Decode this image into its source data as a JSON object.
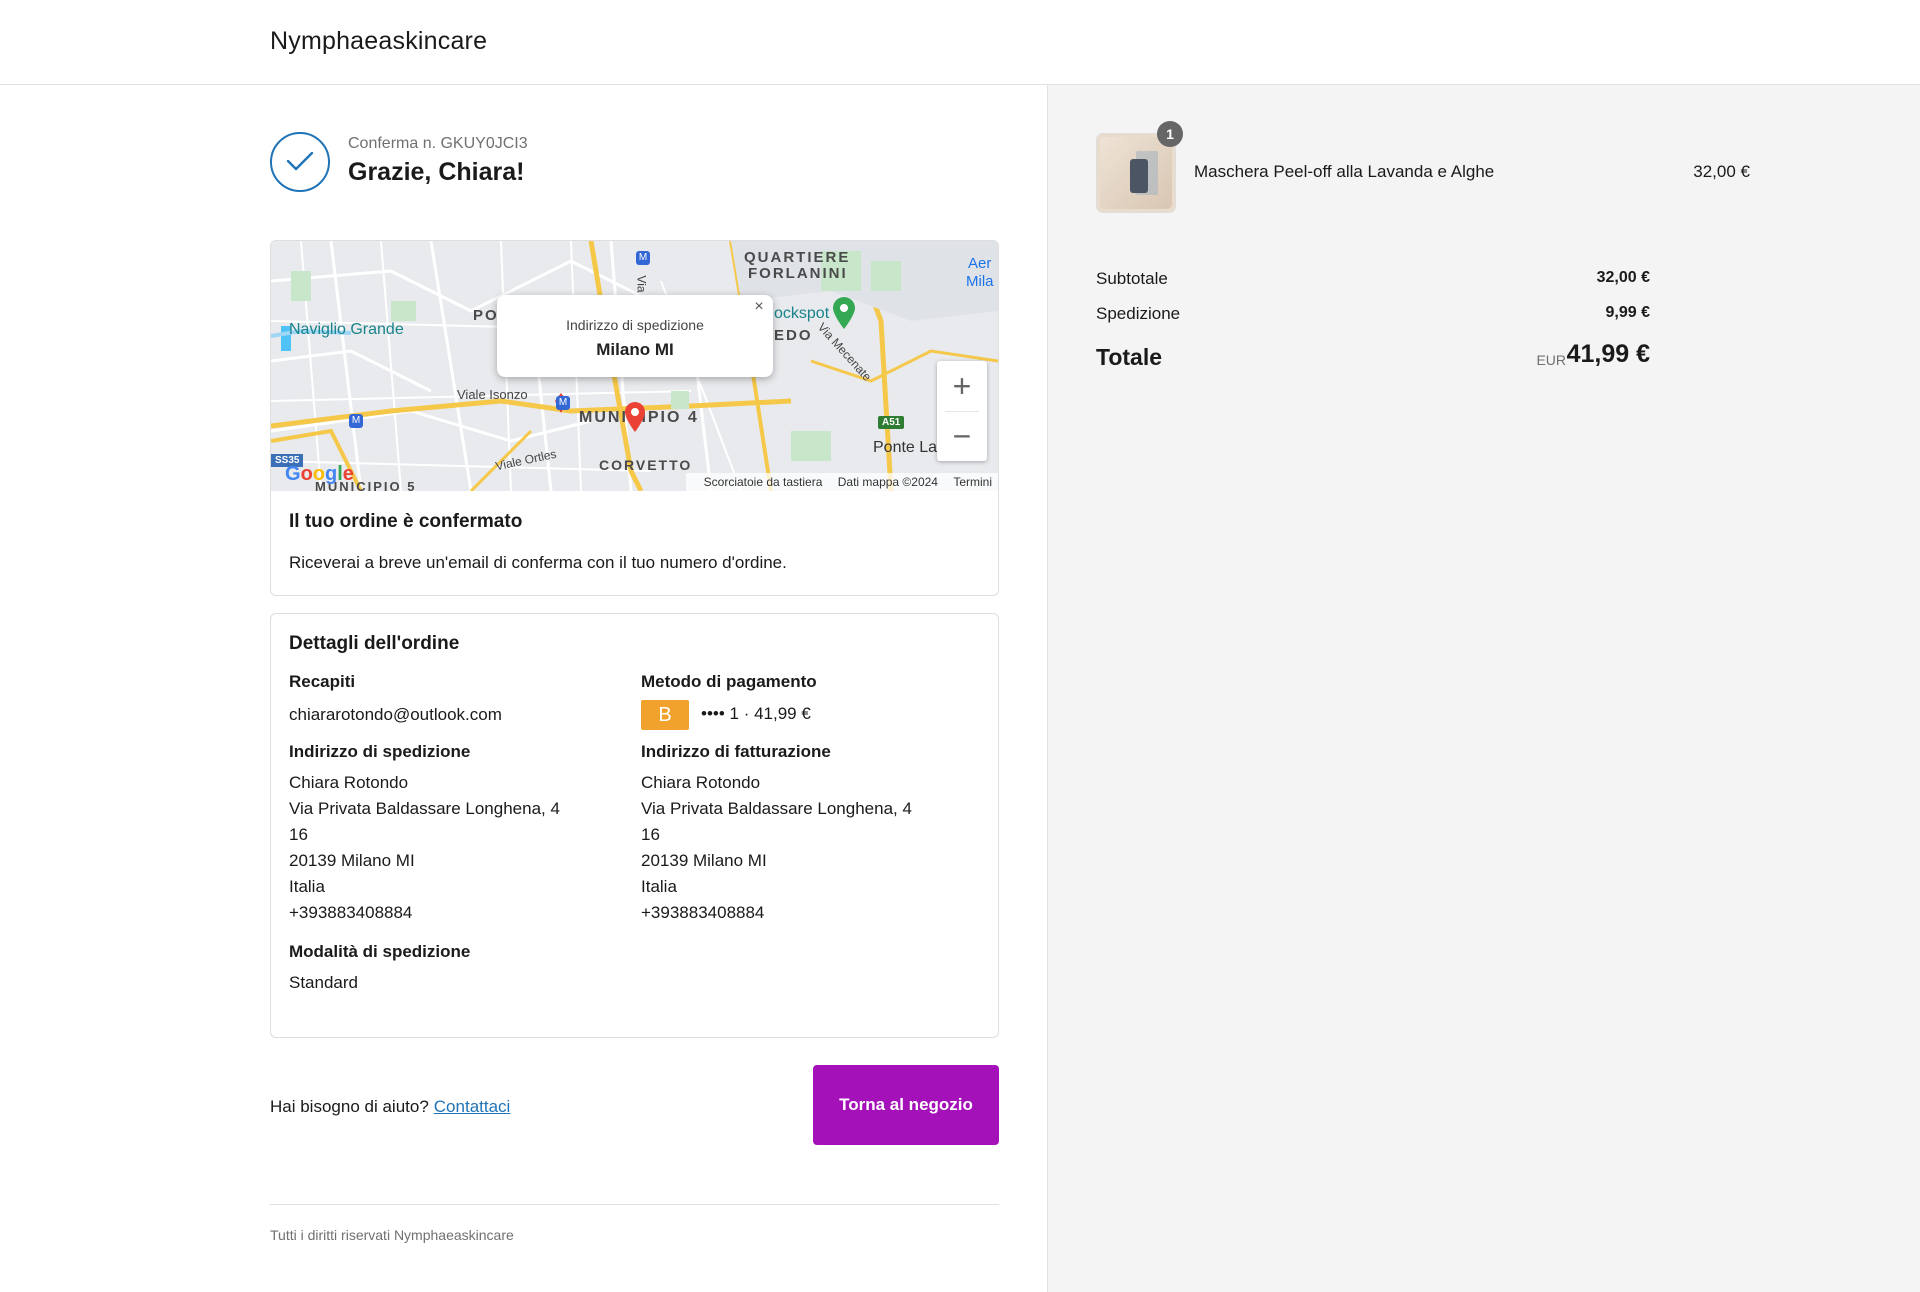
{
  "header": {
    "brand": "Nymphaeaskincare"
  },
  "confirmation": {
    "number_label": "Conferma n. GKUY0JCI3",
    "thanks": "Grazie, Chiara!"
  },
  "map": {
    "popup_label": "Indirizzo di spedizione",
    "popup_city": "Milano MI",
    "close_glyph": "×",
    "zoom_in": "+",
    "zoom_out": "−",
    "labels": {
      "quartiere": "QUARTIERE",
      "forlanini": "FORLANINI",
      "naviglio": "Naviglio Grande",
      "po": "PO",
      "bockspot": "ockspot",
      "edo": "EDO",
      "mecenate": "Via Mecenate",
      "isonzo": "Viale Isonzo",
      "municipio4": "MUNICIPIO 4",
      "corvetto": "CORVETTO",
      "ortles": "Viale Ortles",
      "ponte": "Ponte La",
      "aer": "Aer",
      "mila": "Mila",
      "municipio5": "MUNICIPIO 5",
      "via": "Via",
      "ss35": "SS35",
      "a51": "A51"
    },
    "footer": {
      "shortcuts": "Scorciatoie da tastiera",
      "mapdata": "Dati mappa ©2024",
      "terms": "Termini"
    },
    "logo": {
      "g1": "G",
      "o1": "o",
      "o2": "o",
      "g2": "g",
      "l": "l",
      "e": "e"
    }
  },
  "order_confirmed": {
    "title": "Il tuo ordine è confermato",
    "text": "Riceverai a breve un'email di conferma con il tuo numero d'ordine."
  },
  "details": {
    "title": "Dettagli dell'ordine",
    "contacts_title": "Recapiti",
    "email": "chiararotondo@outlook.com",
    "shipping_title": "Indirizzo di spedizione",
    "shipping": {
      "name": "Chiara Rotondo",
      "line1": "Via Privata Baldassare Longhena, 4",
      "line2": "16",
      "city": "20139 Milano MI",
      "country": "Italia",
      "phone": "+393883408884"
    },
    "method_title": "Modalità di spedizione",
    "method": "Standard",
    "payment_title": "Metodo di pagamento",
    "payment_badge": "B",
    "payment_text": "•••• 1 · 41,99 €",
    "billing_title": "Indirizzo di fatturazione",
    "billing": {
      "name": "Chiara Rotondo",
      "line1": "Via Privata Baldassare Longhena, 4",
      "line2": "16",
      "city": "20139 Milano MI",
      "country": "Italia",
      "phone": "+393883408884"
    }
  },
  "help": {
    "text": "Hai bisogno di aiuto?",
    "link": "Contattaci"
  },
  "back_button": "Torna al negozio",
  "footer": "Tutti i diritti riservati Nymphaeaskincare",
  "summary": {
    "qty": "1",
    "product": "Maschera Peel-off alla Lavanda e Alghe",
    "price": "32,00 €",
    "subtotal_label": "Subtotale",
    "subtotal": "32,00 €",
    "shipping_label": "Spedizione",
    "shipping": "9,99 €",
    "total_label": "Totale",
    "currency": "EUR",
    "total": "41,99 €"
  },
  "colors": {
    "accent_button": "#a511b8",
    "link": "#1f73b7",
    "payment_badge": "#f0a22d",
    "summary_bg": "#f4f4f4"
  }
}
